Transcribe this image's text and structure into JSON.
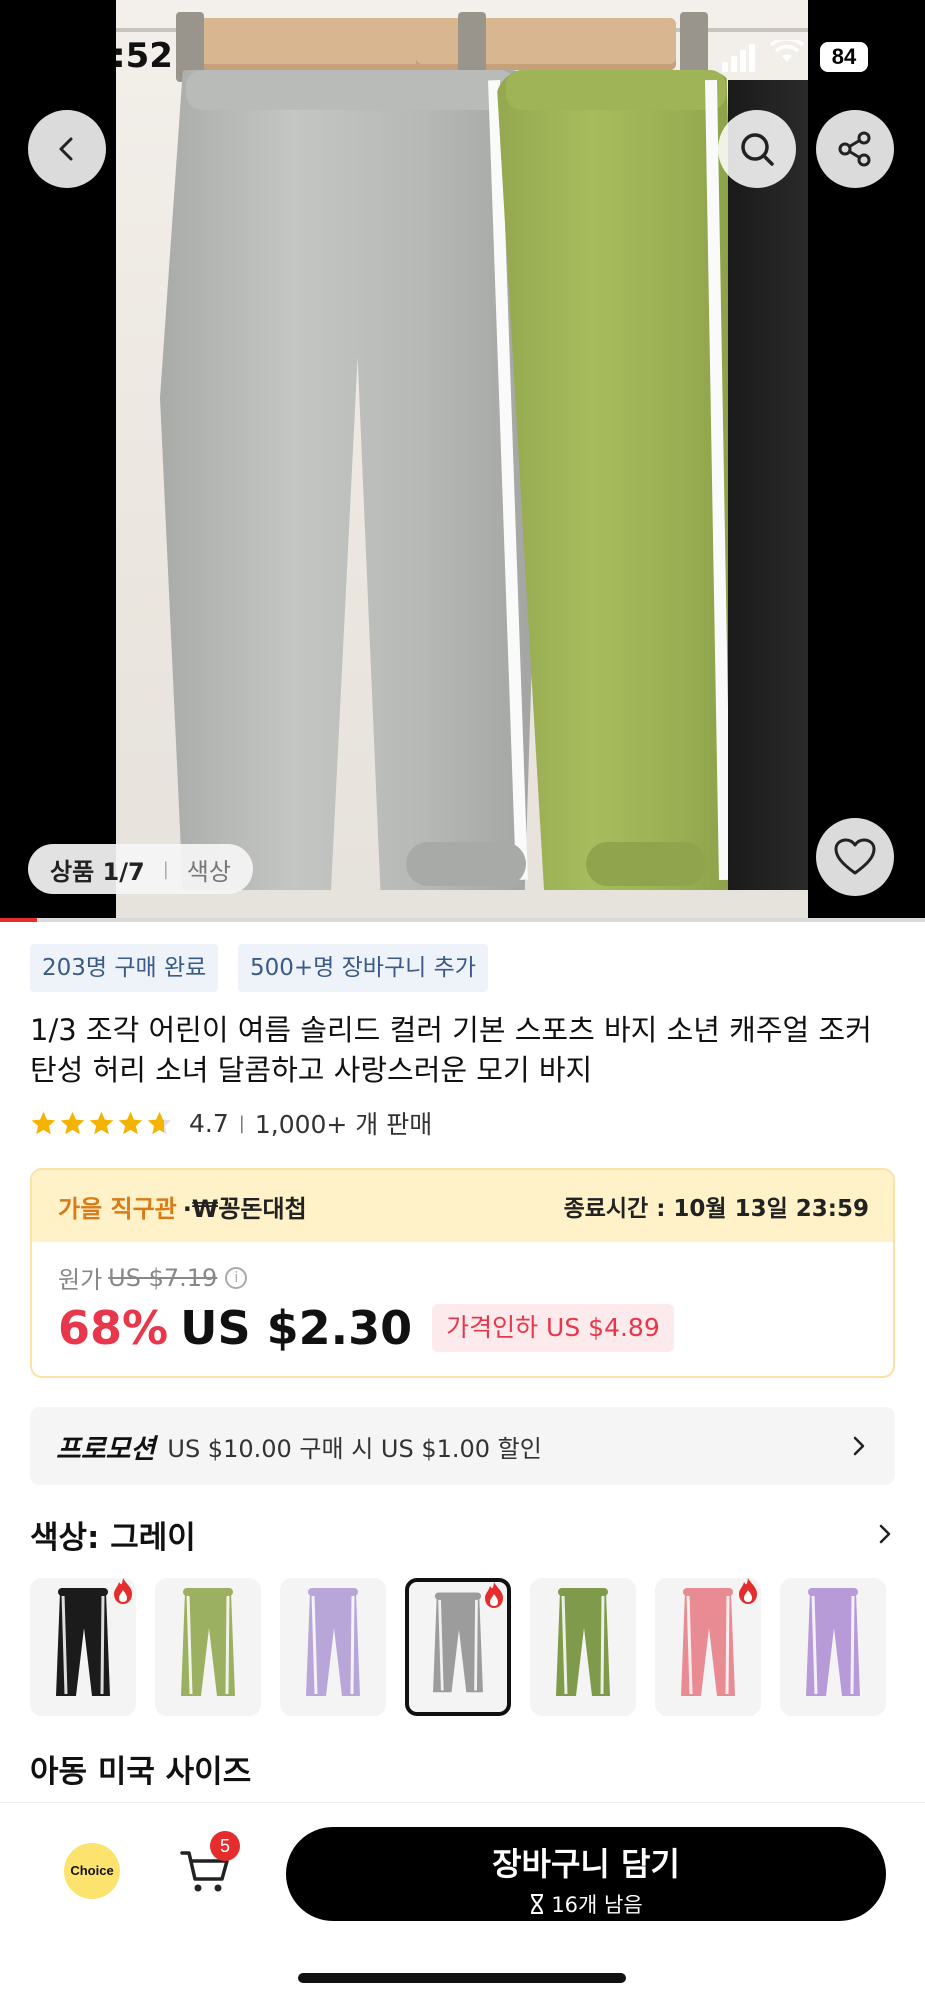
{
  "status": {
    "time": ":52",
    "battery": "84"
  },
  "gallery": {
    "position": "상품 1/7",
    "label": "색상",
    "progress": 0.04
  },
  "tags": [
    "203명 구매 완료",
    "500+명 장바구니 추가"
  ],
  "product": {
    "title": "1/3 조각 어린이 여름 솔리드 컬러 기본 스포츠 바지 소년 캐주얼 조커 탄성 허리 소녀 달콤하고 사랑스러운 모기 바지",
    "rating": "4.7",
    "rating_value": 4.7,
    "sold": "1,000+ 개 판매"
  },
  "deal": {
    "name": "가을 직구관",
    "brand": "·₩꽁돈대첩",
    "end_time": "종료시간 : 10월 13일 23:59",
    "original_label": "원가",
    "original_price": "US $7.19",
    "discount": "68%",
    "price": "US $2.30",
    "price_drop": "가격인하 US $4.89"
  },
  "promotion": {
    "label": "프로모션",
    "text": "US $10.00 구매 시 US $1.00 할인"
  },
  "color": {
    "label": "색상: 그레이",
    "variants": [
      {
        "name": "black",
        "color": "#1b1b1b",
        "hot": true,
        "selected": false
      },
      {
        "name": "mixed",
        "color": "#9bb060",
        "hot": false,
        "selected": false
      },
      {
        "name": "mixed-2",
        "color": "#b9a6d8",
        "hot": false,
        "selected": false
      },
      {
        "name": "gray",
        "color": "#9c9c9c",
        "hot": true,
        "selected": true
      },
      {
        "name": "green",
        "color": "#7f9a4a",
        "hot": false,
        "selected": false
      },
      {
        "name": "pink",
        "color": "#e98b93",
        "hot": true,
        "selected": false
      },
      {
        "name": "purple",
        "color": "#b79ad8",
        "hot": false,
        "selected": false
      }
    ]
  },
  "size": {
    "label": "아동 미국 사이즈"
  },
  "bottom": {
    "choice": "Choice",
    "cart_count": "5",
    "add_to_cart": "장바구니 담기",
    "stock": "16개 남음"
  },
  "colors": {
    "accent": "#e8374a",
    "deal_orange": "#d87b17",
    "tag_blue": "#3b5a85"
  }
}
